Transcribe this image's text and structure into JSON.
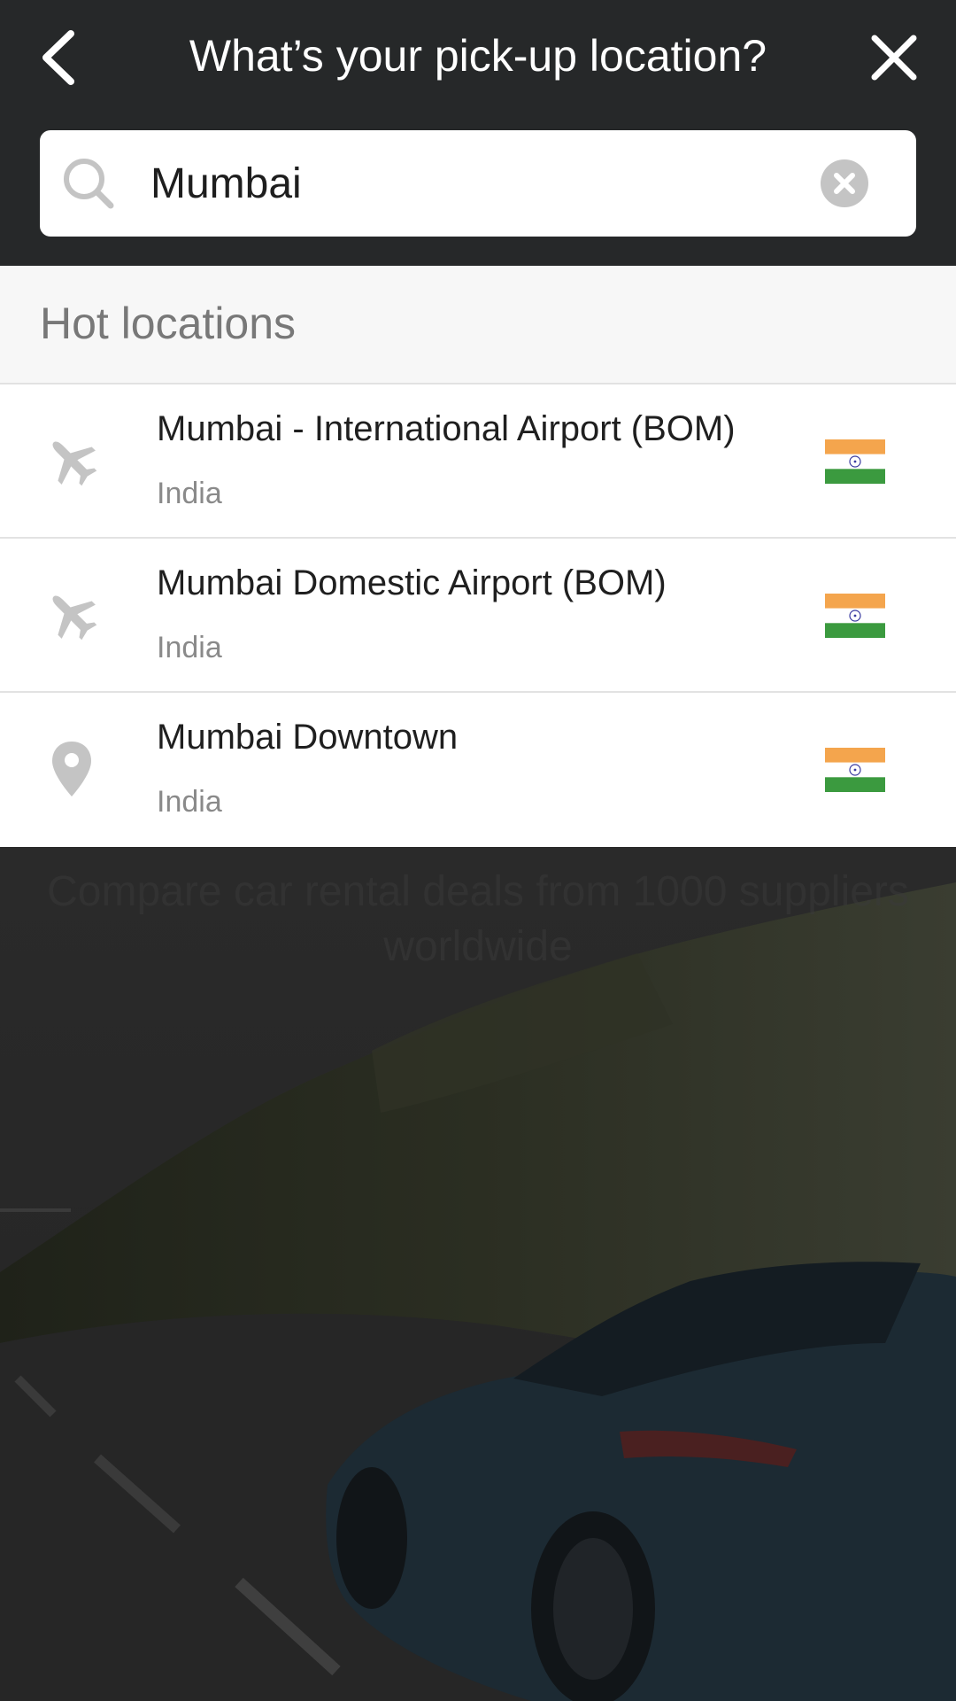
{
  "header": {
    "title": "What’s your pick-up location?",
    "back_icon": "chevron-left-icon",
    "close_icon": "close-icon"
  },
  "search": {
    "value": "Mumbai",
    "icon": "search-icon",
    "clear_icon": "clear-circle-icon"
  },
  "hot_locations": {
    "title": "Hot locations",
    "items": [
      {
        "name": "Mumbai - International Airport (BOM)",
        "country": "India",
        "icon": "airplane-icon",
        "flag": "india-flag"
      },
      {
        "name": "Mumbai Domestic Airport (BOM)",
        "country": "India",
        "icon": "airplane-icon",
        "flag": "india-flag"
      },
      {
        "name": "Mumbai Downtown",
        "country": "India",
        "icon": "map-pin-icon",
        "flag": "india-flag"
      }
    ]
  },
  "background": {
    "headline": "Compare car rental deals from 1000 suppliers worldwide"
  },
  "colors": {
    "header_bg": "#262829",
    "section_bg": "#f7f7f7",
    "icon_gray": "#c4c4c4",
    "flag_saffron": "#f4a54d",
    "flag_green": "#3b9a3f",
    "flag_chakra": "#3a3ba0"
  }
}
